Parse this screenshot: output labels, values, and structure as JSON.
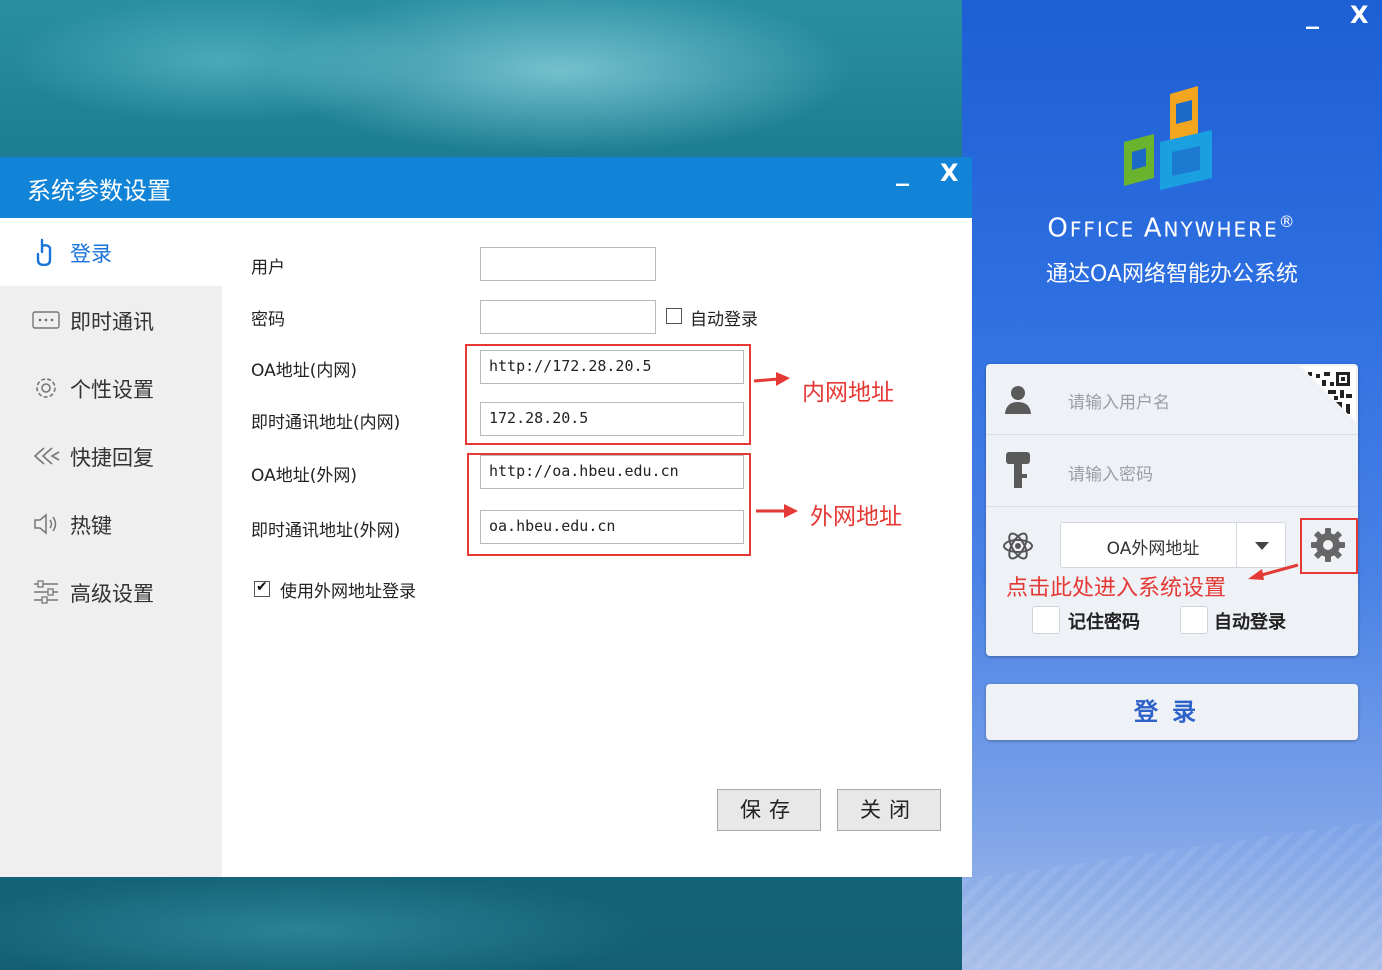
{
  "login_panel": {
    "minimize_label": "_",
    "close_label": "X",
    "brand_title_parts": [
      "O",
      "FFICE ",
      "A",
      "NYWHERE"
    ],
    "brand_registered": "®",
    "brand_subtitle": "通达OA网络智能办公系统",
    "username_placeholder": "请输入用户名",
    "password_placeholder": "请输入密码",
    "server_select_value": "OA外网地址",
    "settings_hint": "点击此处进入系统设置",
    "remember_password_label": "记住密码",
    "auto_login_label": "自动登录",
    "login_button_label": "登录"
  },
  "dialog": {
    "title": "系统参数设置",
    "minimize_label": "_",
    "close_label": "X",
    "nav": [
      {
        "label": "登录",
        "icon": "touch-icon",
        "active": true
      },
      {
        "label": "即时通讯",
        "icon": "chat-icon",
        "active": false
      },
      {
        "label": "个性设置",
        "icon": "gear-icon",
        "active": false
      },
      {
        "label": "快捷回复",
        "icon": "reply-icon",
        "active": false
      },
      {
        "label": "热键",
        "icon": "speaker-icon",
        "active": false
      },
      {
        "label": "高级设置",
        "icon": "advanced-icon",
        "active": false
      }
    ],
    "form": {
      "user_label": "用户",
      "user_value": "",
      "password_label": "密码",
      "password_value": "",
      "auto_login_label": "自动登录",
      "auto_login_checked": false,
      "oa_internal_label": "OA地址(内网)",
      "oa_internal_value": "http://172.28.20.5",
      "im_internal_label": "即时通讯地址(内网)",
      "im_internal_value": "172.28.20.5",
      "oa_external_label": "OA地址(外网)",
      "oa_external_value": "http://oa.hbeu.edu.cn",
      "im_external_label": "即时通讯地址(外网)",
      "im_external_value": "oa.hbeu.edu.cn",
      "use_external_label": "使用外网地址登录",
      "use_external_checked": true
    },
    "annotation_internal": "内网地址",
    "annotation_external": "外网地址",
    "save_label": "保存",
    "close_button_label": "关闭"
  },
  "colors": {
    "dialog_title_bar": "#1184d8",
    "annotation_red": "#e53935",
    "login_panel_blue": "#2d6fe0",
    "active_nav_text": "#1a73d9"
  }
}
